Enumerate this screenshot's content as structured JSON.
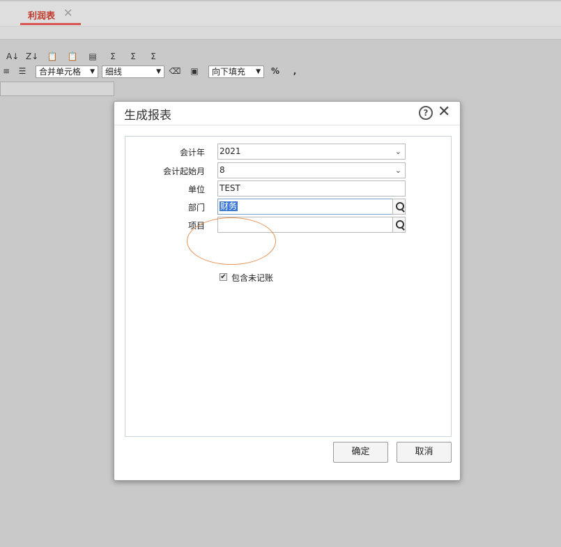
{
  "tab": {
    "label": "利润表",
    "close": "✕"
  },
  "toolbar": {
    "icons": [
      "A↓Z",
      "Z↓A",
      "paste-icon",
      "paste-special-icon",
      "format-icon",
      "Σ",
      "Σ↓",
      "Σ↓"
    ],
    "merge_select": "合并单元格",
    "line_select": "细线",
    "fill_select": "向下填充",
    "percent": "%",
    "comma": ","
  },
  "dialog": {
    "title": "生成报表",
    "help": "?",
    "close": "✕",
    "fields": {
      "year_label": "会计年",
      "year_value": "2021",
      "start_month_label": "会计起始月",
      "start_month_value": "8",
      "unit_label": "单位",
      "unit_value": "TEST",
      "dept_label": "部门",
      "dept_value": "财务",
      "item_label": "项目",
      "item_value": ""
    },
    "checkbox_label": "包含未记账",
    "checkbox_checked": "✔",
    "ok_label": "确定",
    "cancel_label": "取消"
  }
}
